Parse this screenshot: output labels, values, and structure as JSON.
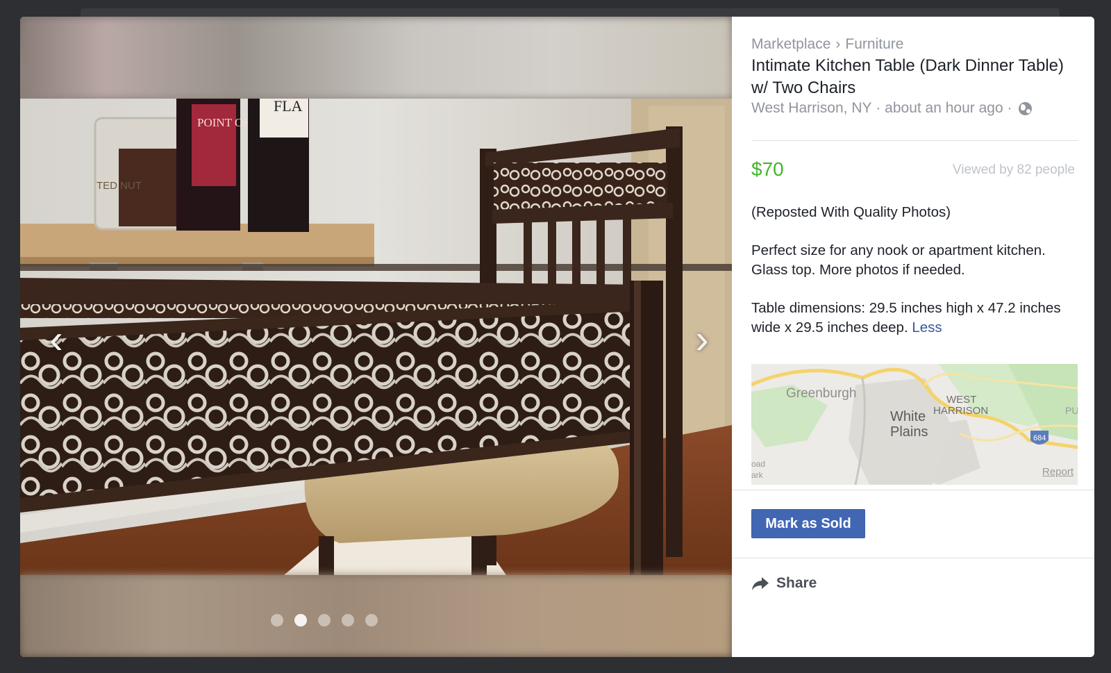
{
  "photo_viewer": {
    "prev_icon": "chevron-left-icon",
    "next_icon": "chevron-right-icon",
    "prev_glyph": "‹",
    "next_glyph": "›",
    "photo_count": 5,
    "active_photo_index": 1,
    "photo_label_bottle_1": "POINT ORMO",
    "photo_label_bottle_2": "FLA",
    "photo_label_candle": "TED NUT"
  },
  "listing": {
    "breadcrumb": [
      "Marketplace",
      "Furniture"
    ],
    "breadcrumb_separator": "›",
    "title": "Intimate Kitchen Table (Dark Dinner Table) w/ Two Chairs",
    "location": "West Harrison, NY",
    "time_ago": "about an hour ago",
    "meta_separator": " · ",
    "privacy_icon": "globe-icon",
    "price": "$70",
    "price_color": "#42b72a",
    "views": "Viewed by 82 people",
    "description": [
      "(Reposted With Quality Photos)",
      "Perfect size for any nook or apartment kitchen. Glass top. More photos if needed.",
      "Table dimensions: 29.5 inches high x 47.2 inches wide x 29.5 inches deep."
    ],
    "less_link": "Less"
  },
  "map": {
    "labels": {
      "greenburgh": "Greenburgh",
      "white": "White",
      "plains": "Plains",
      "west": "WEST",
      "harrison": "HARRISON",
      "pu": "PU",
      "oad": "oad",
      "ark": "ark",
      "route": "684"
    },
    "report": "Report"
  },
  "actions": {
    "mark_sold": "Mark as Sold",
    "mark_sold_color": "#4267b2",
    "share": "Share",
    "share_icon": "share-arrow-icon"
  }
}
